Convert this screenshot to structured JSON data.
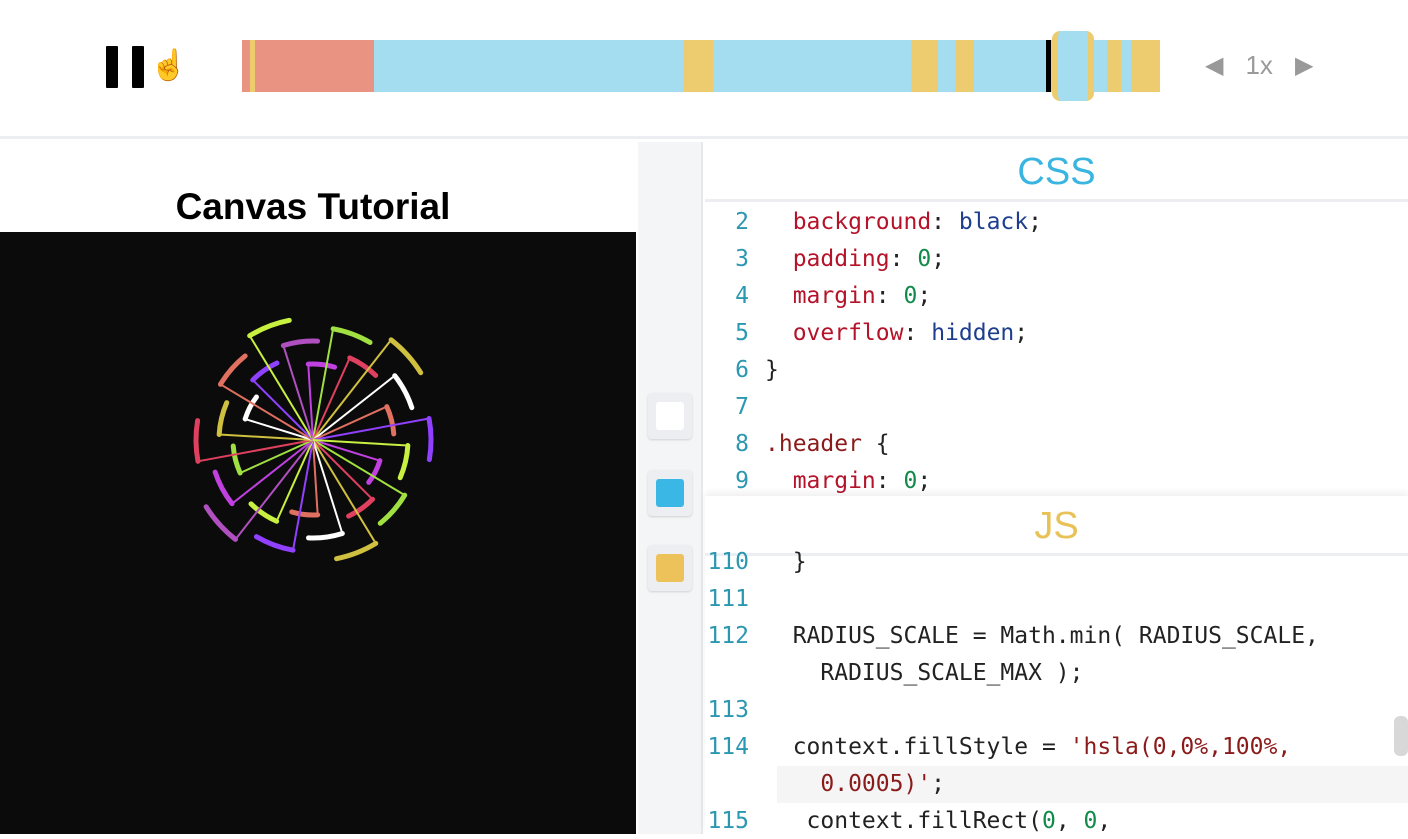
{
  "player": {
    "state": "playing",
    "pause_icon": "pause-icon",
    "cursor_icon": "hand-pointer-icon",
    "speed": "1x",
    "progress": 0.878,
    "segments": [
      {
        "kind": "html",
        "color": "#e99482",
        "weight": 0.9
      },
      {
        "kind": "js",
        "color": "#edcb6f",
        "weight": 0.6
      },
      {
        "kind": "html",
        "color": "#e99482",
        "weight": 13.4
      },
      {
        "kind": "css",
        "color": "#a4dcf0",
        "weight": 34.9
      },
      {
        "kind": "js",
        "color": "#edcb6f",
        "weight": 3.2
      },
      {
        "kind": "css",
        "color": "#a4dcf0",
        "weight": 22.4
      },
      {
        "kind": "js",
        "color": "#edcb6f",
        "weight": 3.0
      },
      {
        "kind": "css",
        "color": "#a4dcf0",
        "weight": 2.0
      },
      {
        "kind": "js",
        "color": "#edcb6f",
        "weight": 2.0
      },
      {
        "kind": "css",
        "color": "#a4dcf0",
        "weight": 5.4
      },
      {
        "kind": "css",
        "color": "#a4dcf0",
        "weight": 4.6
      },
      {
        "kind": "js",
        "color": "#edcb6f",
        "weight": 2.0
      },
      {
        "kind": "css",
        "color": "#a4dcf0",
        "weight": 3.0
      },
      {
        "kind": "js",
        "color": "#edcb6f",
        "weight": 1.6
      },
      {
        "kind": "css",
        "color": "#a4dcf0",
        "weight": 1.1
      },
      {
        "kind": "js",
        "color": "#edcb6f",
        "weight": 3.3
      }
    ]
  },
  "preview": {
    "title": "Canvas Tutorial",
    "art_colors": [
      "#c040e0",
      "#a0e040",
      "#e04060",
      "#d0c040",
      "#ffffff",
      "#e07060",
      "#9040ff",
      "#c8f040",
      "#b050c0"
    ]
  },
  "editors": {
    "swatches": [
      {
        "name": "html",
        "color": "#ffffff"
      },
      {
        "name": "css",
        "color": "#3bb7e6"
      },
      {
        "name": "js",
        "color": "#edc25a"
      }
    ],
    "css": {
      "title": "CSS",
      "color": "#39b5e0",
      "lines": [
        {
          "num": "2",
          "tokens": [
            [
              "  background",
              "k"
            ],
            [
              ": ",
              "p"
            ],
            [
              "black",
              "v"
            ],
            [
              ";",
              "p"
            ]
          ]
        },
        {
          "num": "3",
          "tokens": [
            [
              "  padding",
              "k"
            ],
            [
              ": ",
              "p"
            ],
            [
              "0",
              "n"
            ],
            [
              ";",
              "p"
            ]
          ]
        },
        {
          "num": "4",
          "tokens": [
            [
              "  margin",
              "k"
            ],
            [
              ": ",
              "p"
            ],
            [
              "0",
              "n"
            ],
            [
              ";",
              "p"
            ]
          ]
        },
        {
          "num": "5",
          "tokens": [
            [
              "  overflow",
              "k"
            ],
            [
              ": ",
              "p"
            ],
            [
              "hidden",
              "v"
            ],
            [
              ";",
              "p"
            ]
          ]
        },
        {
          "num": "6",
          "tokens": [
            [
              "}",
              "p"
            ]
          ]
        },
        {
          "num": "7",
          "tokens": []
        },
        {
          "num": "8",
          "tokens": [
            [
              ".header",
              "s"
            ],
            [
              " {",
              "p"
            ]
          ]
        },
        {
          "num": "9",
          "tokens": [
            [
              "  margin",
              "k"
            ],
            [
              ": ",
              "p"
            ],
            [
              "0",
              "n"
            ],
            [
              ";",
              "p"
            ]
          ]
        }
      ]
    },
    "js": {
      "title": "JS",
      "color": "#e8c257",
      "lines": [
        {
          "num": "110",
          "tokens": [
            [
              "  }",
              "p"
            ]
          ]
        },
        {
          "num": "111",
          "tokens": []
        },
        {
          "num": "112",
          "tokens": [
            [
              "  RADIUS_SCALE = Math.min( RADIUS_SCALE,",
              "p"
            ]
          ]
        },
        {
          "num": "",
          "tokens": [
            [
              "    RADIUS_SCALE_MAX );",
              "p"
            ]
          ]
        },
        {
          "num": "113",
          "tokens": []
        },
        {
          "num": "114",
          "tokens": [
            [
              "  context.fillStyle = ",
              "p"
            ],
            [
              "'hsla(0,0%,100%,",
              "s"
            ]
          ]
        },
        {
          "num": "",
          "tokens": [
            [
              "    0.0005)'",
              "s"
            ],
            [
              ";",
              "p"
            ]
          ]
        },
        {
          "num": "115",
          "tokens": [
            [
              "   context.fillRect(",
              "p"
            ],
            [
              "0",
              "n"
            ],
            [
              ", ",
              "p"
            ],
            [
              "0",
              "n"
            ],
            [
              ",",
              "p"
            ]
          ]
        }
      ]
    }
  }
}
